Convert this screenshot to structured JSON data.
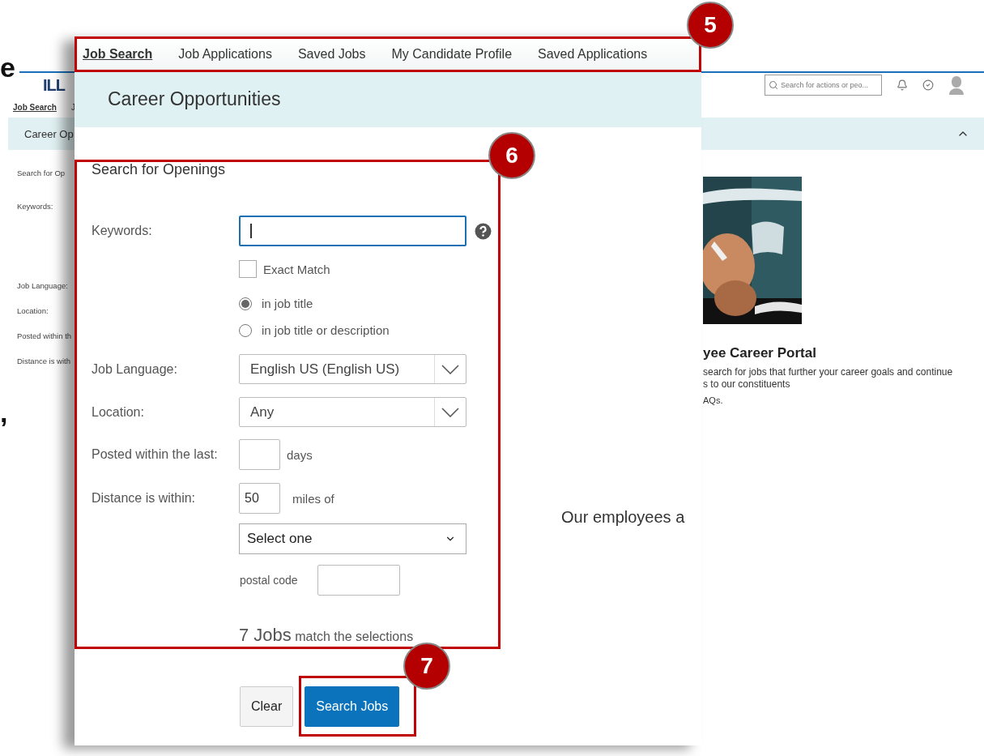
{
  "margin_fragments": [
    "e",
    ","
  ],
  "background_page": {
    "logo": "ILL",
    "search": {
      "placeholder": "Search for actions or peo..."
    },
    "nav": [
      {
        "label": "Job Search",
        "selected": true
      },
      {
        "label": "J",
        "selected": false
      }
    ],
    "band_title": "Career Op",
    "form_labels": [
      "Search for Op",
      "Keywords:",
      "Job Language:",
      "Location:",
      "Posted within th",
      "Distance is with"
    ],
    "portal": {
      "image": {
        "kind": "picture"
      },
      "title": "yee Career Portal",
      "lines": [
        "search for jobs that further your career goals and continue",
        "s to our constituents"
      ],
      "faq": "AQs."
    }
  },
  "panel": {
    "tabs": [
      {
        "label": "Job Search",
        "selected": true
      },
      {
        "label": "Job Applications",
        "selected": false
      },
      {
        "label": "Saved Jobs",
        "selected": false
      },
      {
        "label": "My Candidate Profile",
        "selected": false
      },
      {
        "label": "Saved Applications",
        "selected": false
      }
    ],
    "title": "Career Opportunities",
    "form": {
      "heading": "Search for Openings",
      "keywords": {
        "label": "Keywords:",
        "focused": true
      },
      "exact_match": {
        "label": "Exact Match",
        "checked": false
      },
      "scope": [
        {
          "label": "in job title",
          "selected": true
        },
        {
          "label": "in job title or description",
          "selected": false
        }
      ],
      "language": {
        "label": "Job Language:",
        "value": "English US (English US)"
      },
      "location": {
        "label": "Location:",
        "value": "Any"
      },
      "posted": {
        "label": "Posted within the last:",
        "unit": "days"
      },
      "distance": {
        "label": "Distance is within:",
        "value": "50",
        "unit": "miles of"
      },
      "distance_from": {
        "value": "Select one"
      },
      "postal": {
        "label": "postal code"
      },
      "match": {
        "count": "7 Jobs",
        "text": "match the selections"
      }
    },
    "buttons": [
      {
        "label": "Clear",
        "kind": "secondary"
      },
      {
        "label": "Search Jobs",
        "kind": "primary"
      }
    ],
    "side_text": "Our employees a"
  },
  "callouts": [
    {
      "number": "5"
    },
    {
      "number": "6"
    },
    {
      "number": "7"
    }
  ]
}
